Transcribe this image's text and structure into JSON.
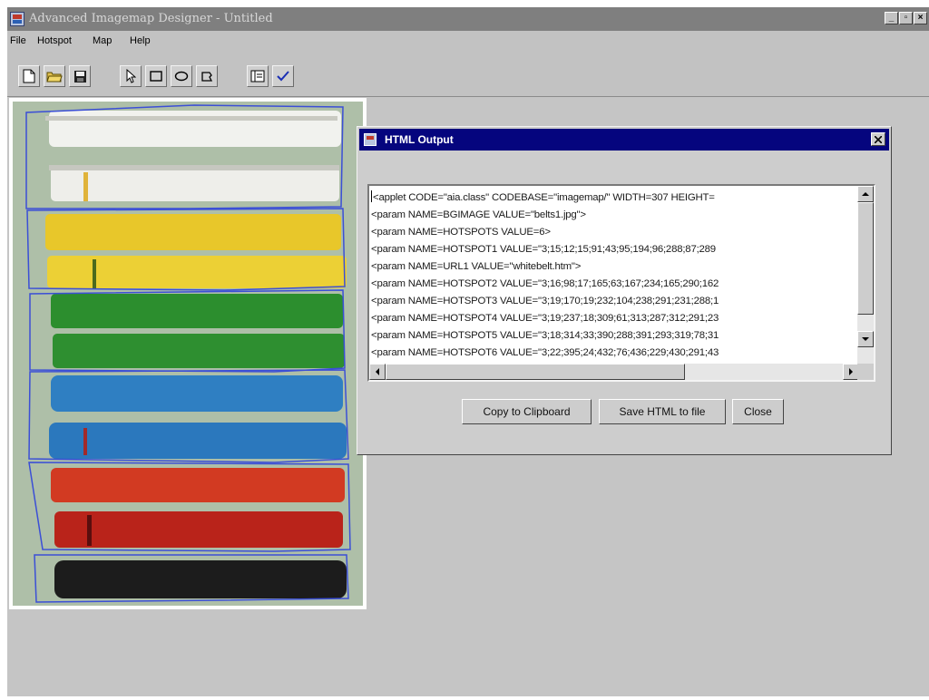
{
  "app": {
    "title": "Advanced Imagemap Designer - Untitled"
  },
  "menu": {
    "items": [
      "File",
      "Hotspot",
      "Map",
      "Help"
    ]
  },
  "toolbar": {
    "buttons": [
      "new-file-icon",
      "open-folder-icon",
      "save-disk-icon",
      "pointer-select-icon",
      "rectangle-tool-icon",
      "ellipse-tool-icon",
      "polygon-tool-icon",
      "html-output-icon",
      "check-icon"
    ]
  },
  "image": {
    "description_hidden": true
  },
  "dialog": {
    "title": "HTML Output",
    "code_lines": [
      "<applet CODE=\"aia.class\" CODEBASE=\"imagemap/\" WIDTH=307 HEIGHT=",
      "<param NAME=BGIMAGE VALUE=\"belts1.jpg\">",
      "<param NAME=HOTSPOTS VALUE=6>",
      "<param NAME=HOTSPOT1 VALUE=\"3;15;12;15;91;43;95;194;96;288;87;289",
      "<param NAME=URL1 VALUE=\"whitebelt.htm\">",
      "<param NAME=HOTSPOT2 VALUE=\"3;16;98;17;165;63;167;234;165;290;162",
      "<param NAME=HOTSPOT3 VALUE=\"3;19;170;19;232;104;238;291;231;288;1",
      "<param NAME=HOTSPOT4 VALUE=\"3;19;237;18;309;61;313;287;312;291;23",
      "<param NAME=HOTSPOT5 VALUE=\"3;18;314;33;390;288;391;293;319;78;31",
      "<param NAME=HOTSPOT6 VALUE=\"3;22;395;24;432;76;436;229;430;291;43"
    ],
    "buttons": {
      "copy": "Copy to Clipboard",
      "save": "Save HTML to file",
      "close": "Close"
    }
  },
  "colors": {
    "dialog_title_bg": "#05057e",
    "hotspot_outline": "#3b4fd6",
    "workspace": "#c5c5c5"
  }
}
